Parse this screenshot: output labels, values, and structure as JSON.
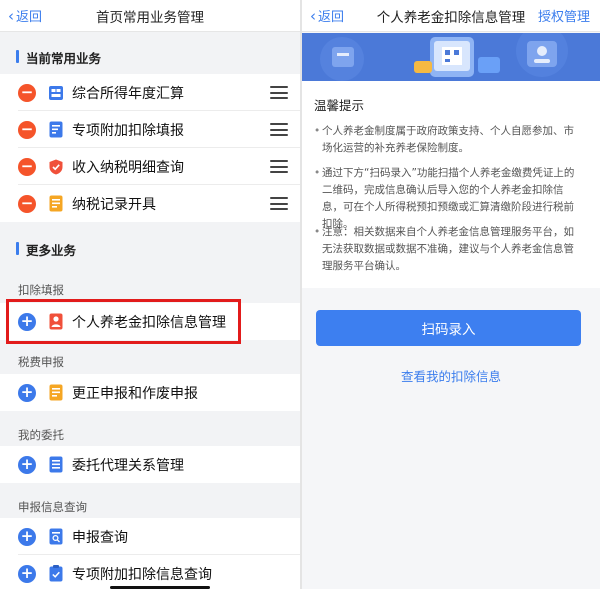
{
  "left": {
    "nav": {
      "back_label": "返回",
      "title": "首页常用业务管理"
    },
    "current_section": {
      "title": "当前常用业务"
    },
    "current_items": [
      {
        "label": "综合所得年度汇算",
        "icon": "grid-chart-icon"
      },
      {
        "label": "专项附加扣除填报",
        "icon": "edit-document-icon"
      },
      {
        "label": "收入纳税明细查询",
        "icon": "shield-icon"
      },
      {
        "label": "纳税记录开具",
        "icon": "receipt-icon"
      }
    ],
    "more_section": {
      "title": "更多业务"
    },
    "groups": [
      {
        "label": "扣除填报",
        "items": [
          {
            "label": "个人养老金扣除信息管理",
            "icon": "pension-user-icon"
          }
        ]
      },
      {
        "label": "税费申报",
        "items": [
          {
            "label": "更正申报和作废申报",
            "icon": "document-icon"
          }
        ]
      },
      {
        "label": "我的委托",
        "items": [
          {
            "label": "委托代理关系管理",
            "icon": "list-document-icon"
          }
        ]
      },
      {
        "label": "申报信息查询",
        "items": [
          {
            "label": "申报查询",
            "icon": "search-document-icon"
          },
          {
            "label": "专项附加扣除信息查询",
            "icon": "clipboard-check-icon"
          }
        ]
      }
    ]
  },
  "right": {
    "nav": {
      "back_label": "返回",
      "title": "个人养老金扣除信息管理",
      "right_label": "授权管理"
    },
    "tips": {
      "title": "温馨提示",
      "bullets": [
        "个人养老金制度属于政府政策支持、个人自愿参加、市场化运营的补充养老保险制度。",
        "通过下方“扫码录入”功能扫描个人养老金缴费凭证上的二维码，完成信息确认后导入您的个人养老金扣除信息，可在个人所得税预扣预缴或汇算清缴阶段进行税前扣除。",
        "注意：相关数据来自个人养老金信息管理服务平台，如无法获取数据或数据不准确，建议与个人养老金信息管理服务平台确认。"
      ]
    },
    "scan_button": "扫码录入",
    "view_link": "查看我的扣除信息"
  },
  "colors": {
    "accent": "#3b7ded",
    "remove": "#f5542a",
    "add": "#3c79ea",
    "highlight": "#e21b1b",
    "banner": "#4b79d8"
  }
}
